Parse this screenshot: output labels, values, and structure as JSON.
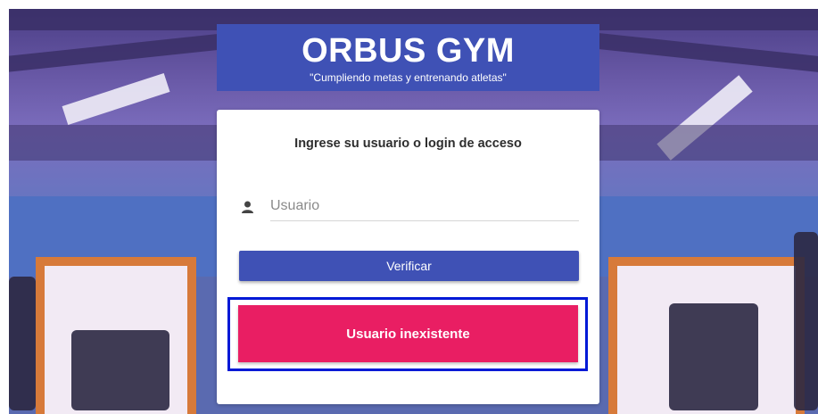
{
  "header": {
    "title": "ORBUS GYM",
    "subtitle": "\"Cumpliendo metas y entrenando atletas\""
  },
  "login": {
    "heading": "Ingrese su usuario o login de acceso",
    "username_placeholder": "Usuario",
    "username_value": "",
    "user_icon": "person-icon",
    "verify_label": "Verificar"
  },
  "alert": {
    "message": "Usuario inexistente",
    "color": "#e91e63"
  },
  "colors": {
    "primary": "#3f51b5",
    "highlight_outline": "#0019d6"
  }
}
